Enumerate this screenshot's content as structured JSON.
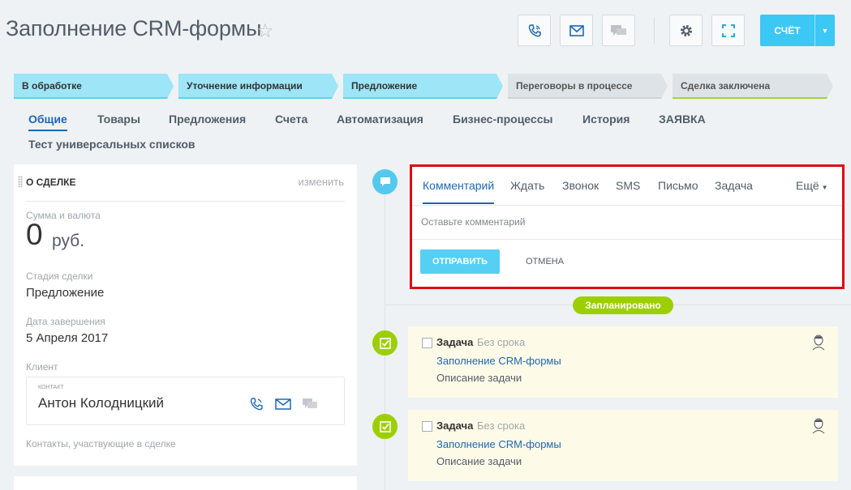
{
  "header": {
    "title": "Заполнение CRM-формы",
    "star_icon": "star-icon",
    "account_button": "СЧЁТ",
    "accent_color": "#3bc8f5"
  },
  "stages": [
    {
      "label": "В обработке",
      "state": "active"
    },
    {
      "label": "Уточнение информации",
      "state": "active"
    },
    {
      "label": "Предложение",
      "state": "active"
    },
    {
      "label": "Переговоры в процессе",
      "state": "inactive"
    },
    {
      "label": "Сделка заключена",
      "state": "inactive"
    }
  ],
  "tabs": [
    {
      "label": "Общие",
      "active": true
    },
    {
      "label": "Товары"
    },
    {
      "label": "Предложения"
    },
    {
      "label": "Счета"
    },
    {
      "label": "Автоматизация"
    },
    {
      "label": "Бизнес-процессы"
    },
    {
      "label": "История"
    },
    {
      "label": "ЗАЯВКА"
    },
    {
      "label": "Тест универсальных списков"
    }
  ],
  "deal_card": {
    "title": "О СДЕЛКЕ",
    "edit_label": "изменить",
    "amount_label": "Сумма и валюта",
    "amount": "0",
    "currency": "руб.",
    "stage_label": "Стадия сделки",
    "stage_value": "Предложение",
    "close_date_label": "Дата завершения",
    "close_date_value": "5 Апреля 2017",
    "client_label": "Клиент",
    "contact_tag": "КОНТАКТ",
    "contact_name": "Антон Колодницкий",
    "participants_label": "Контакты, участвующие в сделке"
  },
  "editor": {
    "tabs": [
      "Комментарий",
      "Ждать",
      "Звонок",
      "SMS",
      "Письмо",
      "Задача"
    ],
    "more_label": "Ещё",
    "placeholder": "Оставьте комментарий",
    "send_label": "ОТПРАВИТЬ",
    "cancel_label": "ОТМЕНА"
  },
  "timeline": {
    "planned_label": "Запланировано",
    "tasks": [
      {
        "type": "Задача",
        "deadline": "Без срока",
        "link": "Заполнение CRM-формы",
        "description": "Описание задачи"
      },
      {
        "type": "Задача",
        "deadline": "Без срока",
        "link": "Заполнение CRM-формы",
        "description": "Описание задачи"
      }
    ]
  }
}
